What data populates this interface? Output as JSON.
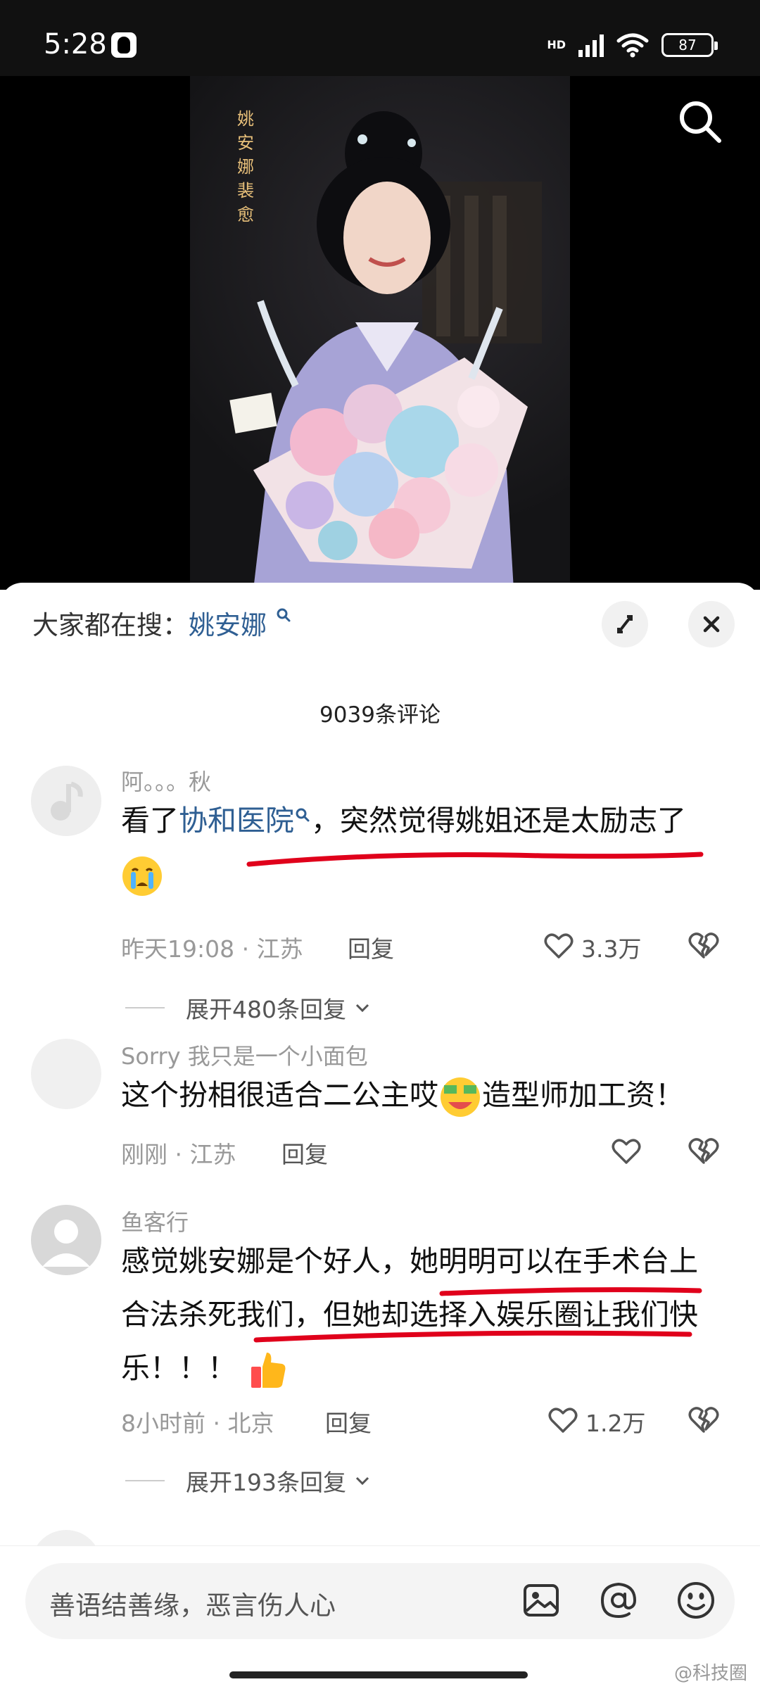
{
  "status_bar": {
    "time": "5:28",
    "network": "HD",
    "battery": "87"
  },
  "video": {
    "overlay_text": "姚安娜 裴愈"
  },
  "sheet": {
    "trending_label": "大家都在搜：",
    "trending_keyword": "姚安娜",
    "comment_count": "9039条评论"
  },
  "comments": [
    {
      "name": "阿。。。秋",
      "text_before": "看了",
      "text_link": "协和医院",
      "text_after": "，突然觉得姚姐还是太励志了",
      "time": "昨天19:08",
      "location": "江苏",
      "reply_label": "回复",
      "likes": "3.3万",
      "expand_replies": "展开480条回复"
    },
    {
      "name": "Sorry 我只是一个小面包",
      "text_before": "这个扮相很适合二公主哎",
      "text_after": "造型师加工资！",
      "time": "刚刚",
      "location": "江苏",
      "reply_label": "回复"
    },
    {
      "name": "鱼客行",
      "text": "感觉姚安娜是个好人，她明明可以在手术台上合法杀死我们，但她却选择入娱乐圈让我们快乐！！！",
      "time": "8小时前",
      "location": "北京",
      "reply_label": "回复",
      "likes": "1.2万",
      "expand_replies": "展开193条回复"
    }
  ],
  "input": {
    "placeholder": "善语结善缘，恶言伤人心"
  },
  "watermark": "@科技圈",
  "colors": {
    "link": "#2f5f93",
    "underline": "#e0001b",
    "status_bar_bg": "#111111"
  }
}
